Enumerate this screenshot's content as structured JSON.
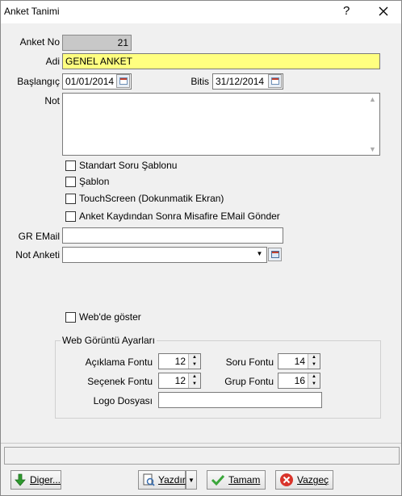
{
  "window": {
    "title": "Anket Tanimi",
    "help_label": "?"
  },
  "form": {
    "anket_no_label": "Anket No",
    "anket_no_value": "21",
    "adi_label": "Adi",
    "adi_value": "GENEL ANKET",
    "baslangic_label": "Başlangıç",
    "baslangic_value": "01/01/2014",
    "bitis_label": "Bitis",
    "bitis_value": "31/12/2014",
    "not_label": "Not",
    "not_value": "",
    "checkboxes": [
      {
        "label": "Standart Soru Şablonu",
        "checked": false
      },
      {
        "label": "Şablon",
        "checked": false
      },
      {
        "label": "TouchScreen (Dokunmatik Ekran)",
        "checked": false
      },
      {
        "label": "Anket Kaydından Sonra Misafire EMail Gönder",
        "checked": false
      }
    ],
    "gr_email_label": "GR EMail",
    "gr_email_value": "",
    "not_anketi_label": "Not Anketi",
    "not_anketi_value": "",
    "webde_goster_label": "Web'de göster",
    "webde_goster_checked": false
  },
  "web_group": {
    "title": "Web Görüntü Ayarları",
    "aciklama_label": "Açıklama Fontu",
    "aciklama_value": "12",
    "soru_label": "Soru Fontu",
    "soru_value": "14",
    "secenek_label": "Seçenek Fontu",
    "secenek_value": "12",
    "grup_label": "Grup Fontu",
    "grup_value": "16",
    "logo_label": "Logo Dosyası",
    "logo_value": ""
  },
  "buttons": {
    "diger": "Diger...",
    "yazdir": "Yazdır",
    "tamam": "Tamam",
    "vazgec": "Vazgeç"
  },
  "colors": {
    "yellow_field": "#ffff80",
    "grey_field": "#c8c8c8",
    "green_check": "#3aa63a",
    "red_cancel": "#d9342b"
  }
}
